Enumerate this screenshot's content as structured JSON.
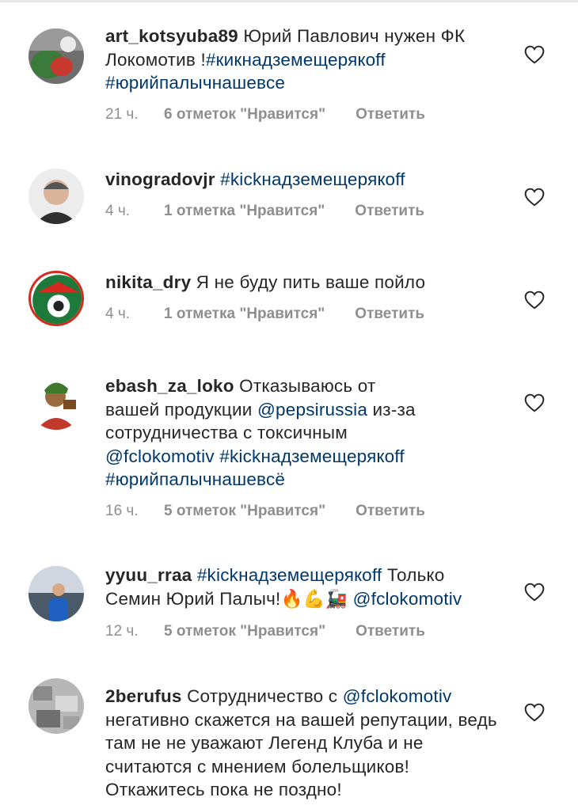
{
  "comments": [
    {
      "username": "art_kotsyuba89",
      "segments": [
        {
          "t": "Юрий Павлович нужен ФК Локомотив !",
          "tag": false
        },
        {
          "t": "#кикнадземещерякoff #юрийпалычнашевсе",
          "tag": true
        }
      ],
      "time": "21 ч.",
      "likes": "6 отметок \"Нравится\"",
      "reply": "Ответить"
    },
    {
      "username": "vinogradovjr",
      "segments": [
        {
          "t": "#kickнадземещерякoff",
          "tag": true
        }
      ],
      "time": "4 ч.",
      "likes": "1 отметка \"Нравится\"",
      "reply": "Ответить"
    },
    {
      "username": "nikita_dry",
      "segments": [
        {
          "t": "Я не буду пить ваше пойло",
          "tag": false
        }
      ],
      "time": "4 ч.",
      "likes": "1 отметка \"Нравится\"",
      "reply": "Ответить"
    },
    {
      "username": "ebash_za_loko",
      "segments": [
        {
          "t": "Отказываюсь от вашей продукции ",
          "tag": false
        },
        {
          "t": "@pepsirussia",
          "tag": true
        },
        {
          "t": " из-за сотрудничества с токсичным ",
          "tag": false
        },
        {
          "t": "@fclokomotiv #kickнадземещерякoff #юрийпалычнашевсё",
          "tag": true
        }
      ],
      "time": "16 ч.",
      "likes": "5 отметок \"Нравится\"",
      "reply": "Ответить"
    },
    {
      "username": "yyuu_rraa",
      "segments": [
        {
          "t": "#kickнадземещерякoff",
          "tag": true
        },
        {
          "t": " Только Семин Юрий Палыч!🔥💪🚂 ",
          "tag": false
        },
        {
          "t": "@fclokomotiv",
          "tag": true
        }
      ],
      "time": "12 ч.",
      "likes": "5 отметок \"Нравится\"",
      "reply": "Ответить"
    },
    {
      "username": "2berufus",
      "segments": [
        {
          "t": "Сотрудничество с ",
          "tag": false
        },
        {
          "t": "@fclokomotiv",
          "tag": true
        },
        {
          "t": " негативно скажется на вашей репутации, ведь там не не уважают Легенд Клуба и не считаются с мнением болельщиков! Откажитесь пока не поздно!",
          "tag": false
        }
      ],
      "time": "",
      "likes": "",
      "reply": ""
    }
  ],
  "colors": {
    "username": "#262626",
    "hashtag": "#00376b",
    "meta": "#8e8e8e",
    "loko_red": "#d52b1e",
    "loko_green": "#1d7a3a"
  },
  "icons": {
    "like": "heart-outline-icon"
  }
}
